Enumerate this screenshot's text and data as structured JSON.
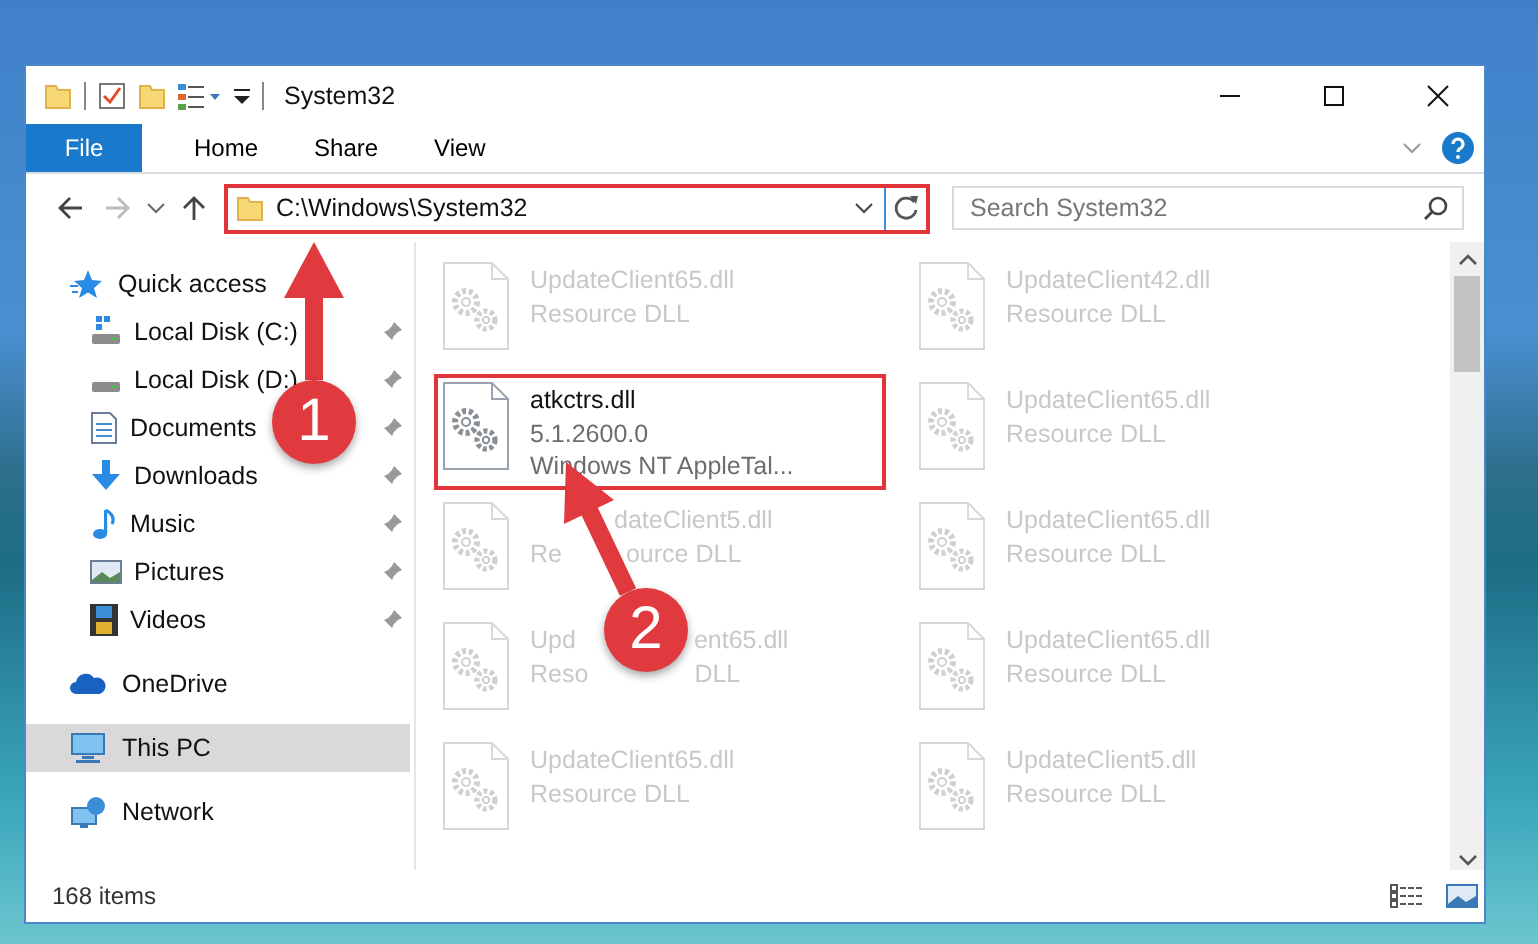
{
  "window": {
    "title": "System32"
  },
  "ribbon_tabs": [
    {
      "label": "File",
      "kind": "file"
    },
    {
      "label": "Home",
      "kind": "tab"
    },
    {
      "label": "Share",
      "kind": "tab"
    },
    {
      "label": "View",
      "kind": "tab"
    }
  ],
  "address_bar": {
    "path": "C:\\Windows\\System32",
    "highlighted": true
  },
  "search": {
    "placeholder": "Search System32"
  },
  "navigation": [
    {
      "label": "Quick access",
      "selected": false,
      "children": [
        {
          "label": "Local Disk (C:)",
          "pinned": true,
          "selected": false
        },
        {
          "label": "Local Disk (D:)",
          "pinned": true,
          "selected": false
        },
        {
          "label": "Documents",
          "pinned": true,
          "selected": false
        },
        {
          "label": "Downloads",
          "pinned": true,
          "selected": false
        },
        {
          "label": "Music",
          "pinned": true,
          "selected": false
        },
        {
          "label": "Pictures",
          "pinned": true,
          "selected": false
        },
        {
          "label": "Videos",
          "pinned": true,
          "selected": false
        }
      ]
    },
    {
      "label": "OneDrive",
      "selected": false
    },
    {
      "label": "This PC",
      "selected": true
    },
    {
      "label": "Network",
      "selected": false
    }
  ],
  "files": [
    {
      "name": "UpdateClient65.dll",
      "details": [
        "Resource DLL"
      ],
      "blurred": true,
      "highlighted": false
    },
    {
      "name": "UpdateClient42.dll",
      "details": [
        "Resource DLL"
      ],
      "blurred": true,
      "highlighted": false
    },
    {
      "name": "atkctrs.dll",
      "details": [
        "5.1.2600.0",
        "Windows NT AppleTal..."
      ],
      "blurred": false,
      "highlighted": true
    },
    {
      "name": "UpdateClient65.dll",
      "details": [
        "Resource DLL"
      ],
      "blurred": true,
      "highlighted": false
    },
    {
      "name": [
        "dateClient5.dll"
      ],
      "details": [
        [
          "Re",
          "ource DLL"
        ]
      ],
      "blurred": true,
      "highlighted": false
    },
    {
      "name": "UpdateClient65.dll",
      "details": [
        "Resource DLL"
      ],
      "blurred": true,
      "highlighted": false
    },
    {
      "name": [
        "Upd",
        "ent65.dll"
      ],
      "details": [
        [
          "Reso",
          "DLL"
        ]
      ],
      "blurred": true,
      "highlighted": false
    },
    {
      "name": "UpdateClient65.dll",
      "details": [
        "Resource DLL"
      ],
      "blurred": true,
      "highlighted": false
    },
    {
      "name": "UpdateClient65.dll",
      "details": [
        "Resource DLL"
      ],
      "blurred": true,
      "highlighted": false
    },
    {
      "name": "UpdateClient5.dll",
      "details": [
        "Resource DLL"
      ],
      "blurred": true,
      "highlighted": false
    }
  ],
  "status_bar": {
    "item_count": "168 items"
  },
  "annotations": [
    {
      "label": "1"
    },
    {
      "label": "2"
    }
  ]
}
